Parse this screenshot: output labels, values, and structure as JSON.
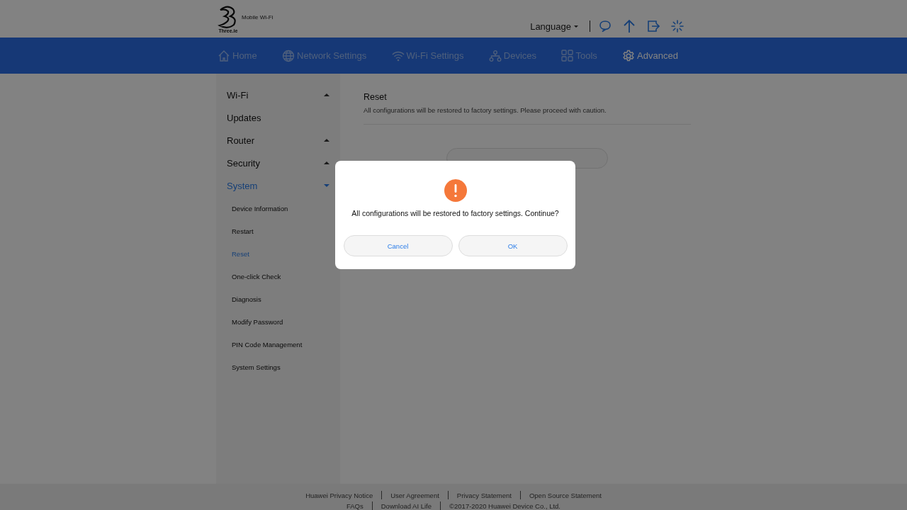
{
  "header": {
    "brand": "Mobile Wi-Fi",
    "logo_caption": "Three.ie",
    "language": "Language"
  },
  "nav": [
    {
      "label": "Home",
      "selected": false
    },
    {
      "label": "Network Settings",
      "selected": false
    },
    {
      "label": "Wi-Fi Settings",
      "selected": false
    },
    {
      "label": "Devices",
      "selected": false
    },
    {
      "label": "Tools",
      "selected": false
    },
    {
      "label": "Advanced",
      "selected": true
    }
  ],
  "sidebar": [
    {
      "label": "Wi-Fi",
      "kind": "group",
      "expanded": false,
      "selected": false
    },
    {
      "label": "Updates",
      "kind": "link",
      "selected": false
    },
    {
      "label": "Router",
      "kind": "group",
      "expanded": false,
      "selected": false
    },
    {
      "label": "Security",
      "kind": "group",
      "expanded": false,
      "selected": false
    },
    {
      "label": "System",
      "kind": "group",
      "expanded": true,
      "selected": true,
      "children": [
        {
          "label": "Device Information",
          "selected": false
        },
        {
          "label": "Restart",
          "selected": false
        },
        {
          "label": "Reset",
          "selected": true
        },
        {
          "label": "One-click Check",
          "selected": false
        },
        {
          "label": "Diagnosis",
          "selected": false
        },
        {
          "label": "Modify Password",
          "selected": false
        },
        {
          "label": "PIN Code Management",
          "selected": false
        },
        {
          "label": "System Settings",
          "selected": false
        }
      ]
    }
  ],
  "content": {
    "title": "Reset",
    "description": "All configurations will be restored to factory settings. Please proceed with caution."
  },
  "dialog": {
    "message": "All configurations will be restored to factory settings. Continue?",
    "buttons": [
      "Cancel",
      "OK"
    ]
  },
  "footer": {
    "row_1": [
      "Huawei Privacy Notice",
      "User Agreement",
      "Privacy Statement",
      "Open Source Statement"
    ],
    "row_2": [
      "FAQs",
      "Download AI Life",
      "©2017-2020 Huawei Device Co., Ltd."
    ]
  }
}
